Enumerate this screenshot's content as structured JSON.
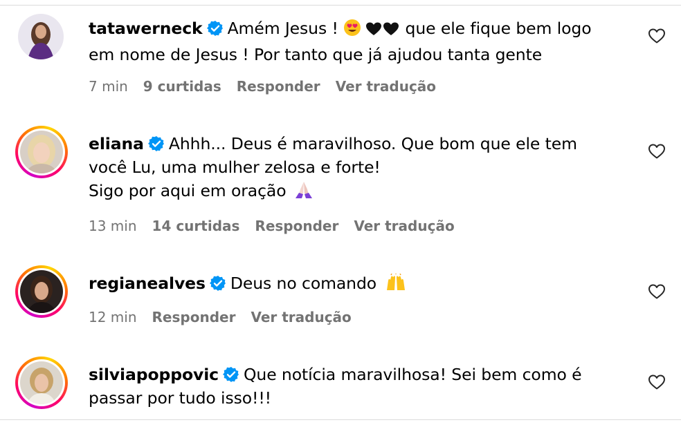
{
  "comments": [
    {
      "username": "tatawerneck",
      "lines": [
        "Amém Jesus ! 😍 🖤🖤 que ele fique bem logo",
        "em nome de Jesus ! Por tanto que já ajudou tanta gente"
      ],
      "text_part1": "Amém Jesus ! ",
      "emoji1": "heart-eyes-emoji",
      "emoji2": "black-hearts-emoji",
      "text_part2": " que ele fique bem logo",
      "line2": "em nome de Jesus ! Por tanto que já ajudou tanta gente",
      "time": "7 min",
      "likes": "9 curtidas",
      "reply": "Responder",
      "translate": "Ver tradução"
    },
    {
      "username": "eliana",
      "line1": "Ahhh... Deus é maravilhoso. Que bom que ele tem",
      "line2": "você Lu, uma mulher zelosa e forte!",
      "line3": "Sigo por aqui em oração",
      "emoji": "praying-hands-emoji",
      "time": "13 min",
      "likes": "14 curtidas",
      "reply": "Responder",
      "translate": "Ver tradução"
    },
    {
      "username": "regianealves",
      "line1": "Deus no comando",
      "emoji": "raising-hands-emoji",
      "time": "12 min",
      "reply": "Responder",
      "translate": "Ver tradução"
    },
    {
      "username": "silviapoppovic",
      "line1": "Que notícia maravilhosa! Sei bem como é",
      "line2": "passar por tudo isso!!!"
    }
  ],
  "colors": {
    "verified": "#0095f6",
    "meta": "#737373",
    "divider": "#dbdbdb"
  },
  "icons": {
    "like": "heart-outline-icon",
    "verified": "verified-badge-icon"
  }
}
